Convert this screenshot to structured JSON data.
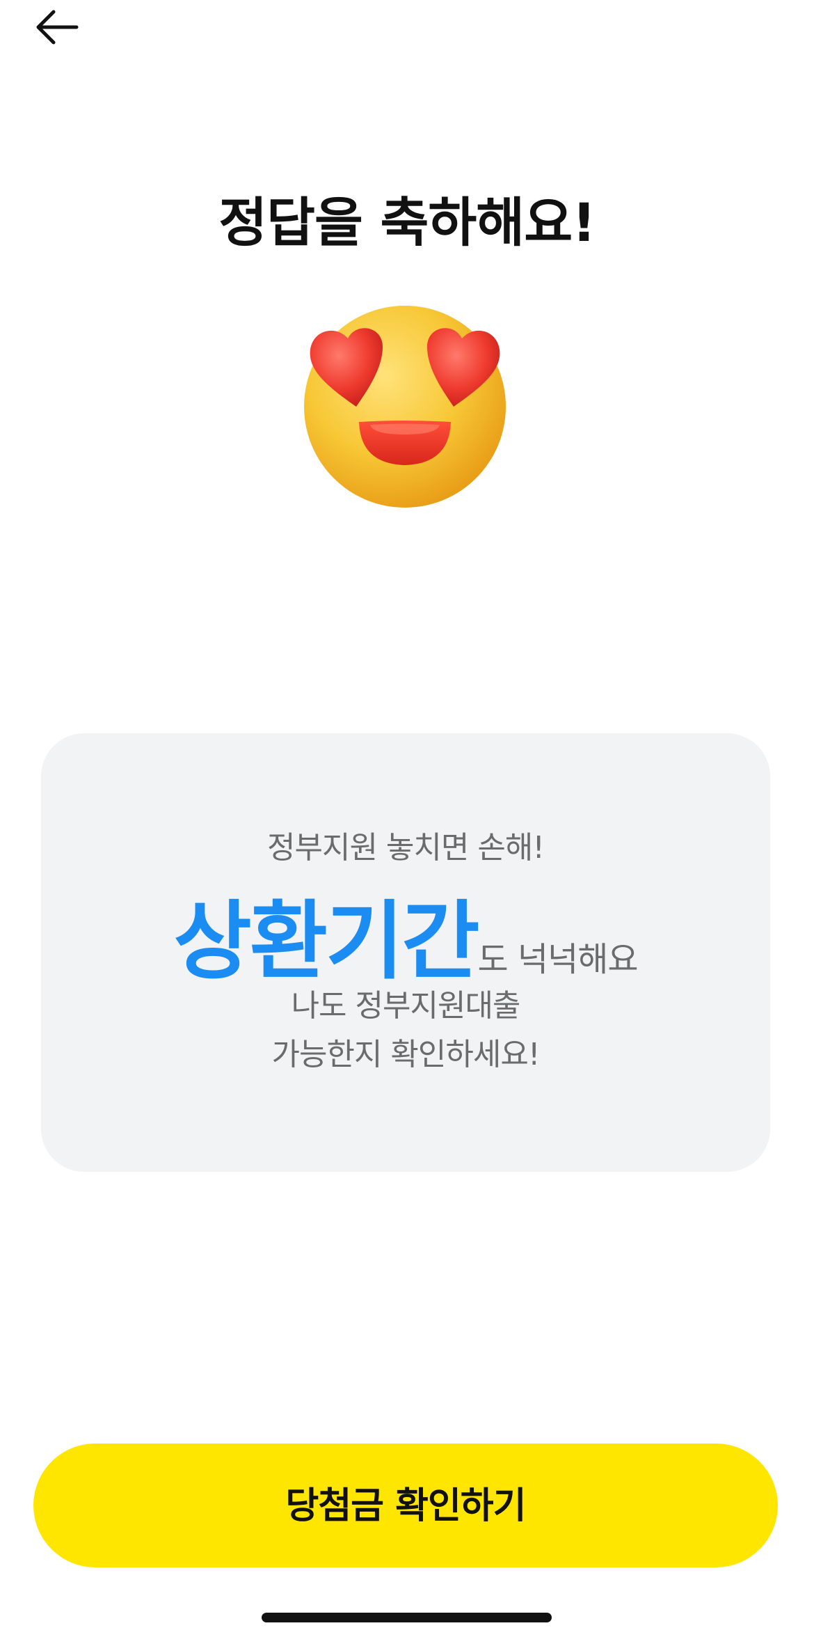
{
  "header": {
    "back_icon": "arrow-left-icon"
  },
  "title": "정답을 축하해요!",
  "emoji": {
    "icon": "heart-eyes-face-icon",
    "colors": {
      "face": "#f6c431",
      "hearts": "#ef3b2f",
      "mouth": "#e8332a"
    }
  },
  "card": {
    "line1": "정부지원 놓치면 손해!",
    "highlight": "상환기간",
    "highlight_suffix": "도 넉넉해요",
    "line3": "나도 정부지원대출",
    "line4": "가능한지 확인하세요!",
    "colors": {
      "background": "#f2f3f5",
      "highlight": "#1a8cf2",
      "text": "#6b6b6b"
    }
  },
  "cta": {
    "label": "당첨금 확인하기",
    "color": "#ffe600"
  }
}
